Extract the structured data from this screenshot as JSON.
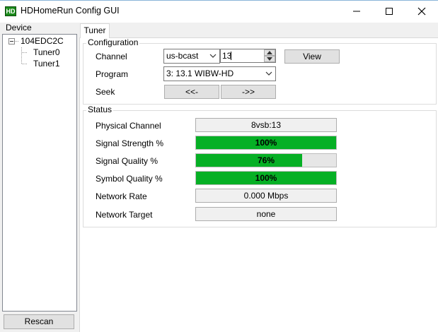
{
  "window": {
    "title": "HDHomeRun Config GUI",
    "icon_text": "HD"
  },
  "device_panel": {
    "label": "Device",
    "tree": {
      "root": "104EDC2C",
      "children": [
        "Tuner0",
        "Tuner1"
      ]
    },
    "rescan_label": "Rescan"
  },
  "tabs": [
    {
      "label": "Tuner",
      "selected": true
    }
  ],
  "configuration": {
    "title": "Configuration",
    "channel_label": "Channel",
    "channel_map": "us-bcast",
    "channel_value": "13",
    "view_label": "View",
    "program_label": "Program",
    "program_value": "3: 13.1 WIBW-HD",
    "seek_label": "Seek",
    "seek_prev": "<<-",
    "seek_next": "->>"
  },
  "status": {
    "title": "Status",
    "physical_channel_label": "Physical Channel",
    "physical_channel": "8vsb:13",
    "signal_strength_label": "Signal Strength %",
    "signal_strength_text": "100%",
    "signal_strength": 100,
    "signal_quality_label": "Signal Quality %",
    "signal_quality_text": "76%",
    "signal_quality": 76,
    "symbol_quality_label": "Symbol Quality %",
    "symbol_quality_text": "100%",
    "symbol_quality": 100,
    "network_rate_label": "Network Rate",
    "network_rate": "0.000 Mbps",
    "network_target_label": "Network Target",
    "network_target": "none"
  },
  "colors": {
    "progress_fill": "#06b025"
  }
}
